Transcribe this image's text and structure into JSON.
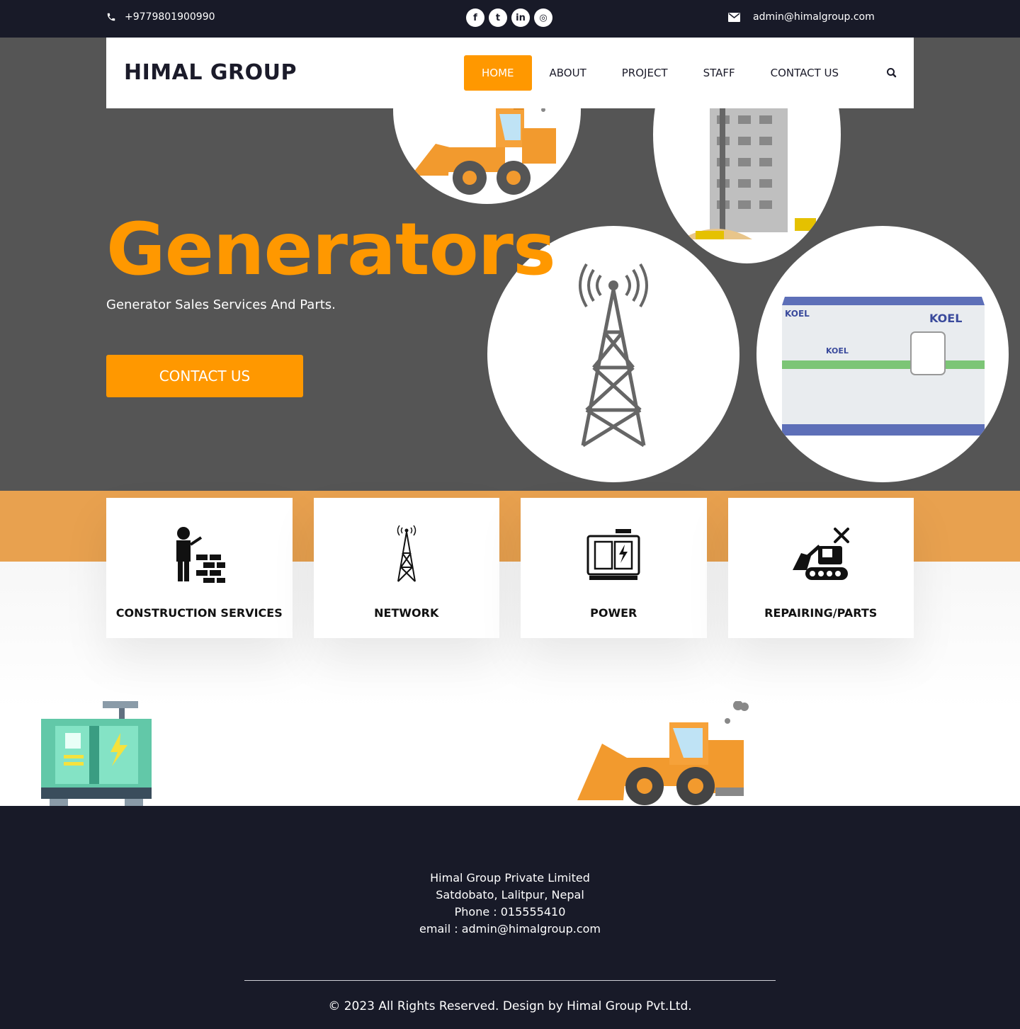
{
  "topbar": {
    "phone": "+9779801900990",
    "email": "admin@himalgroup.com",
    "socials": [
      {
        "icon": "facebook-icon",
        "glyph": "f"
      },
      {
        "icon": "twitter-icon",
        "glyph": "t"
      },
      {
        "icon": "linkedin-icon",
        "glyph": "in"
      },
      {
        "icon": "instagram-icon",
        "glyph": "◎"
      }
    ]
  },
  "header": {
    "logo": "HIMAL GROUP",
    "nav": [
      "HOME",
      "ABOUT",
      "PROJECT",
      "STAFF",
      "CONTACT US"
    ],
    "active_nav": "HOME",
    "search_icon": "search-icon"
  },
  "hero": {
    "title": "Generators",
    "subtitle": "Generator Sales Services And Parts.",
    "cta": "CONTACT US"
  },
  "services": [
    {
      "label": "CONSTRUCTION SERVICES",
      "icon": "construction-worker-icon"
    },
    {
      "label": "NETWORK",
      "icon": "tower-icon"
    },
    {
      "label": "POWER",
      "icon": "generator-icon"
    },
    {
      "label": "REPAIRING/PARTS",
      "icon": "excavator-repair-icon"
    }
  ],
  "footer": {
    "company": "Himal Group Private Limited",
    "address": "Satdobato, Lalitpur, Nepal",
    "phone": "Phone : 015555410",
    "email": "email : admin@himalgroup.com",
    "copyright": "© 2023 All Rights Reserved. Design by Himal Group Pvt.Ltd."
  },
  "colors": {
    "accent": "#ff9800",
    "dark": "#181a28",
    "band": "#e8a14f",
    "hero_bg": "#555555"
  }
}
